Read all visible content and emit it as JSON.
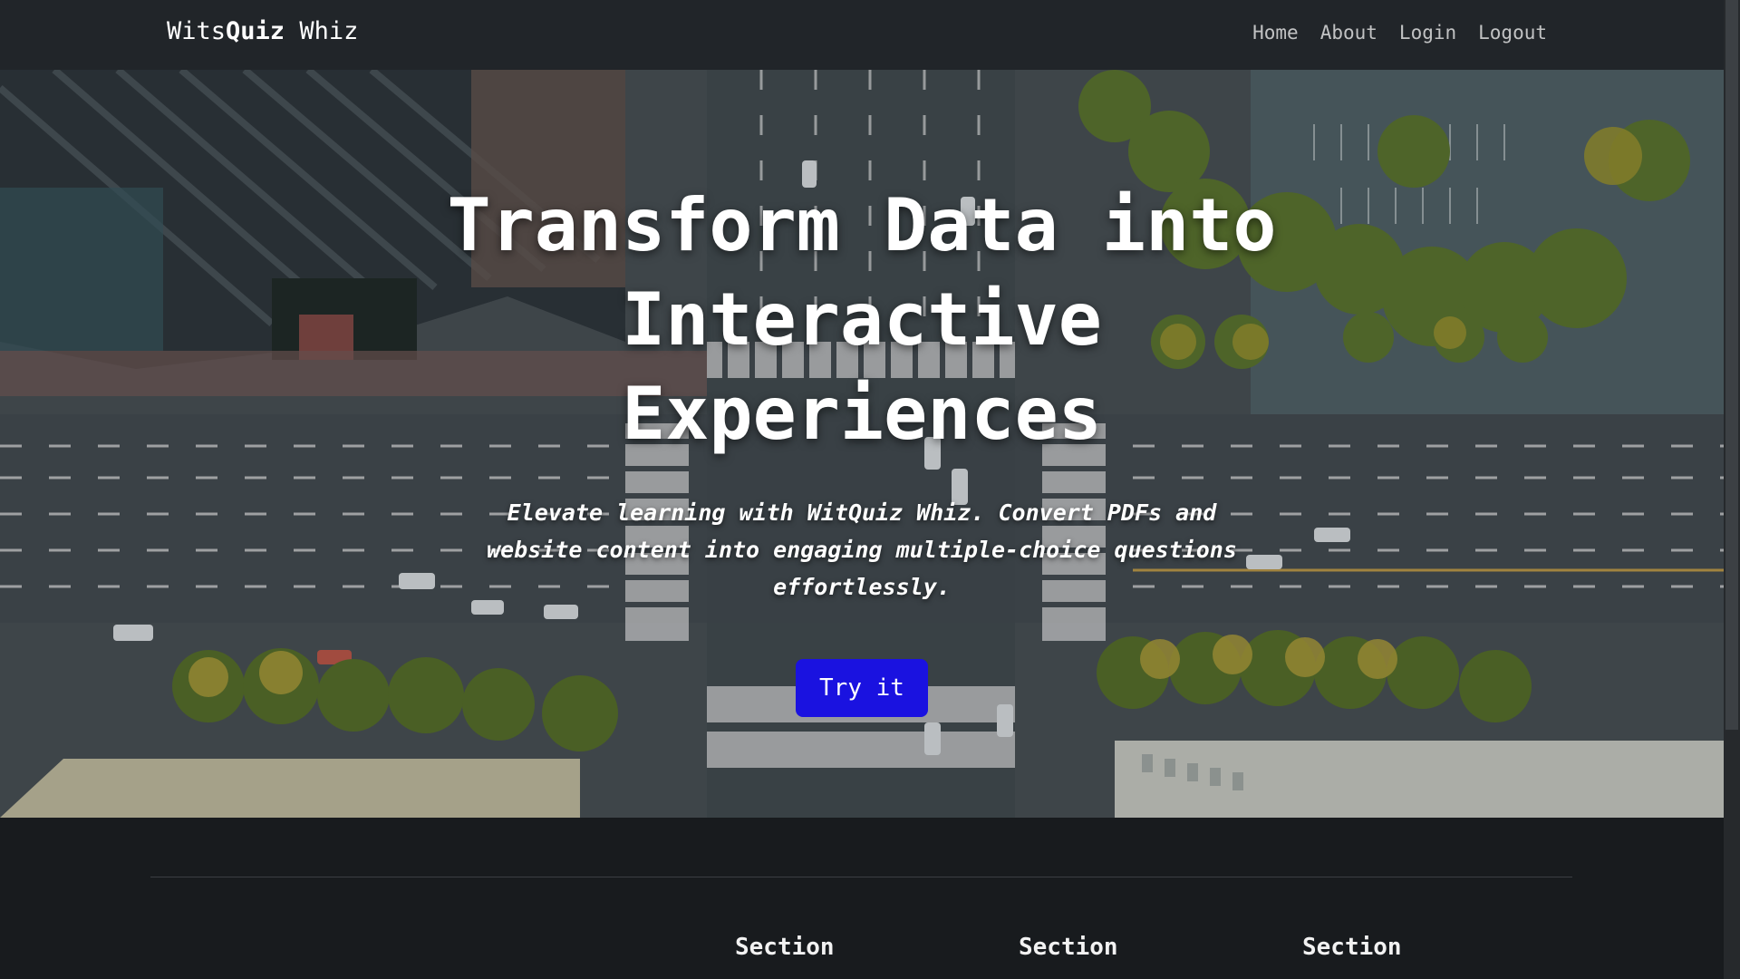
{
  "navbar": {
    "brand_prefix": "Wits",
    "brand_bold": "Quiz",
    "brand_suffix": " Whiz",
    "links": [
      "Home",
      "About",
      "Login",
      "Logout"
    ]
  },
  "hero": {
    "title": "Transform Data into Interactive Experiences",
    "subtitle": "Elevate learning with WitQuiz Whiz. Convert PDFs and website content into engaging multiple-choice questions effortlessly.",
    "button_label": "Try it",
    "background_image": "aerial-city-intersection"
  },
  "sections": [
    "Section",
    "Section",
    "Section"
  ],
  "colors": {
    "navbar_bg": "#212529",
    "page_bg": "#181b1e",
    "button_bg": "#1a12e0"
  }
}
